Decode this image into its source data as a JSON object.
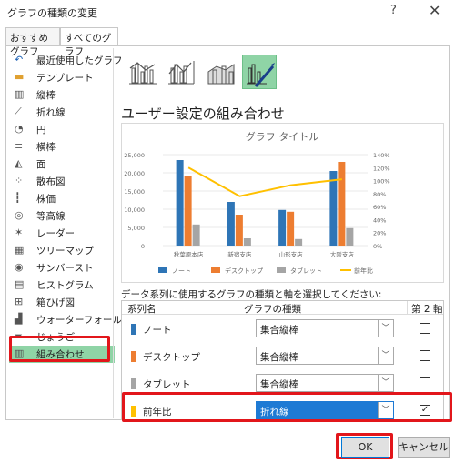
{
  "window": {
    "title": "グラフの種類の変更",
    "help": "?",
    "close": "✕"
  },
  "tabs": [
    {
      "label": "おすすめグラフ",
      "active": false
    },
    {
      "label": "すべてのグラフ",
      "active": true
    }
  ],
  "sidebar": {
    "items": [
      {
        "label": "最近使用したグラフ",
        "icon": "recent-icon"
      },
      {
        "label": "テンプレート",
        "icon": "folder-icon"
      },
      {
        "label": "縦棒",
        "icon": "column-chart-icon"
      },
      {
        "label": "折れ線",
        "icon": "line-chart-icon"
      },
      {
        "label": "円",
        "icon": "pie-chart-icon"
      },
      {
        "label": "横棒",
        "icon": "bar-chart-icon"
      },
      {
        "label": "面",
        "icon": "area-chart-icon"
      },
      {
        "label": "散布図",
        "icon": "scatter-chart-icon"
      },
      {
        "label": "株価",
        "icon": "stock-chart-icon"
      },
      {
        "label": "等高線",
        "icon": "surface-chart-icon"
      },
      {
        "label": "レーダー",
        "icon": "radar-chart-icon"
      },
      {
        "label": "ツリーマップ",
        "icon": "treemap-icon"
      },
      {
        "label": "サンバースト",
        "icon": "sunburst-icon"
      },
      {
        "label": "ヒストグラム",
        "icon": "histogram-icon"
      },
      {
        "label": "箱ひげ図",
        "icon": "boxplot-icon"
      },
      {
        "label": "ウォーターフォール",
        "icon": "waterfall-icon"
      },
      {
        "label": "じょうご",
        "icon": "funnel-icon"
      },
      {
        "label": "組み合わせ",
        "icon": "combo-chart-icon",
        "selected": true
      }
    ]
  },
  "variants": [
    {
      "icon": "clustered-column-line-icon"
    },
    {
      "icon": "clustered-column-line-secondary-icon"
    },
    {
      "icon": "stacked-area-column-icon"
    },
    {
      "icon": "custom-combination-icon",
      "selected": true
    }
  ],
  "heading": "ユーザー設定の組み合わせ",
  "chart_data": {
    "type": "bar",
    "title": "グラフ タイトル",
    "categories": [
      "秋葉原本店",
      "新宿支店",
      "山形支店",
      "大阪支店"
    ],
    "series": [
      {
        "name": "ノート",
        "type": "bar",
        "axis": "primary",
        "color": "#2e75b6",
        "values": [
          23500,
          12000,
          9800,
          20500
        ]
      },
      {
        "name": "デスクトップ",
        "type": "bar",
        "axis": "primary",
        "color": "#ed7d31",
        "values": [
          19000,
          8500,
          9300,
          23000
        ]
      },
      {
        "name": "タブレット",
        "type": "bar",
        "axis": "primary",
        "color": "#a5a5a5",
        "values": [
          5800,
          2000,
          1800,
          4800
        ]
      },
      {
        "name": "前年比",
        "type": "line",
        "axis": "secondary",
        "color": "#ffc000",
        "values": [
          1.2,
          0.76,
          0.93,
          1.02
        ]
      }
    ],
    "y_ticks": [
      "25,000",
      "20,000",
      "15,000",
      "10,000",
      "5,000",
      "0"
    ],
    "y2_ticks": [
      "140%",
      "120%",
      "100%",
      "80%",
      "60%",
      "40%",
      "20%",
      "0%"
    ],
    "ylim": [
      0,
      25000
    ],
    "y2lim": [
      0,
      1.4
    ],
    "legend": "bottom"
  },
  "series_prompt": "データ系列に使用するグラフの種類と軸を選択してください:",
  "series_table": {
    "headers": {
      "name": "系列名",
      "type": "グラフの種類",
      "axis": "第 2 軸"
    },
    "rows": [
      {
        "name": "ノート",
        "color": "#2e75b6",
        "type": "集合縦棒",
        "secondary": false,
        "selected": false
      },
      {
        "name": "デスクトップ",
        "color": "#ed7d31",
        "type": "集合縦棒",
        "secondary": false,
        "selected": false
      },
      {
        "name": "タブレット",
        "color": "#a5a5a5",
        "type": "集合縦棒",
        "secondary": false,
        "selected": false
      },
      {
        "name": "前年比",
        "color": "#ffc000",
        "type": "折れ線",
        "secondary": true,
        "selected": true
      }
    ]
  },
  "buttons": {
    "ok": "OK",
    "cancel": "キャンセル"
  },
  "colors": {
    "highlight": "#8fd4a6",
    "callout": "#e2161b",
    "selected_dropdown": "#1e7ad4"
  }
}
